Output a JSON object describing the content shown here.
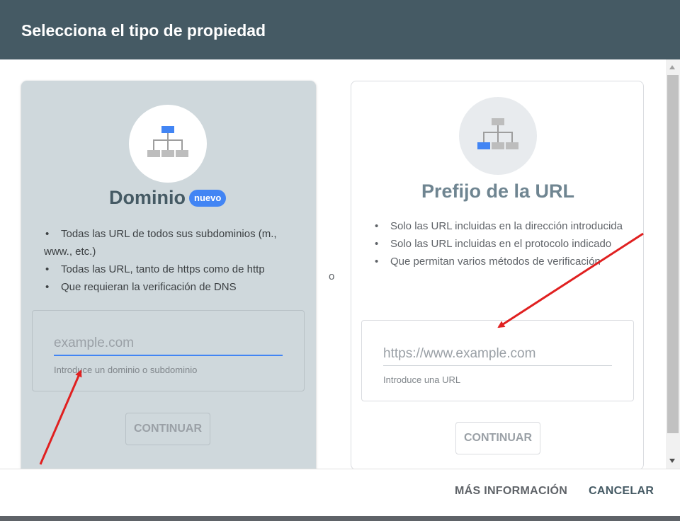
{
  "dialog": {
    "title": "Selecciona el tipo de propiedad",
    "separator": "o"
  },
  "domain_card": {
    "title": "Dominio",
    "badge": "nuevo",
    "bullets": [
      "Todas las URL de todos sus subdominios (m., www., etc.)",
      "Todas las URL, tanto de https como de http",
      "Que requieran la verificación de DNS"
    ],
    "input": {
      "placeholder": "example.com",
      "value": ""
    },
    "hint": "Introduce un dominio o subdominio",
    "button": "CONTINUAR",
    "icon": "sitemap-icon"
  },
  "prefix_card": {
    "title": "Prefijo de la URL",
    "bullets": [
      "Solo las URL incluidas en la dirección introducida",
      "Solo las URL incluidas en el protocolo indicado",
      "Que permitan varios métodos de verificación"
    ],
    "input": {
      "placeholder": "https://www.example.com",
      "value": ""
    },
    "hint": "Introduce una URL",
    "button": "CONTINUAR",
    "icon": "sitemap-icon"
  },
  "footer": {
    "more_info": "MÁS INFORMACIÓN",
    "cancel": "CANCELAR"
  },
  "colors": {
    "header_bg": "#455a64",
    "accent": "#4285f4",
    "domain_card_bg": "#cfd8dc",
    "annotation_arrow": "#e02020"
  }
}
